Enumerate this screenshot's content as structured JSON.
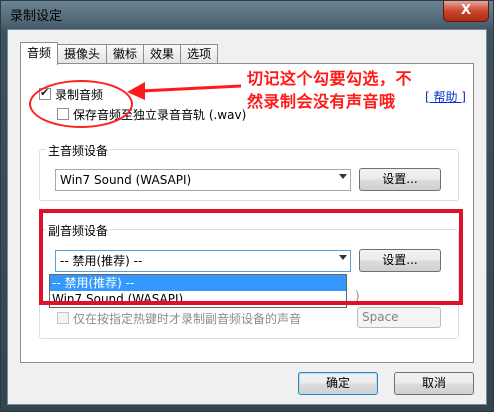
{
  "window": {
    "title": "录制设定",
    "close_label": "X"
  },
  "tabs": [
    {
      "label": "音频",
      "active": true
    },
    {
      "label": "摄像头",
      "active": false
    },
    {
      "label": "徽标",
      "active": false
    },
    {
      "label": "效果",
      "active": false
    },
    {
      "label": "选项",
      "active": false
    }
  ],
  "audio": {
    "record_audio_label": "录制音频",
    "record_audio_checked": true,
    "save_separate_label": "保存音频至独立录音音轨 (.wav)",
    "save_separate_checked": false,
    "help_link": "[ 帮助 ]"
  },
  "main_device": {
    "group_title": "主音频设备",
    "selected": "Win7 Sound (WASAPI)",
    "settings_label": "设置..."
  },
  "sub_device": {
    "group_title": "副音频设备",
    "selected": "-- 禁用(推荐) --",
    "settings_label": "设置...",
    "options": [
      "-- 禁用(推荐) --",
      "Win7 Sound (WASAPI)"
    ],
    "hotkey_label": "仅在按指定热键时才录制副音频设备的声音",
    "hotkey_value": "Space",
    "partial_glyph": ")"
  },
  "footer": {
    "ok_label": "确定",
    "cancel_label": "取消"
  },
  "annotation": {
    "text": "切记这个勾要勾选，不然录制会没有声音哦",
    "color": "#ff1a1a"
  }
}
